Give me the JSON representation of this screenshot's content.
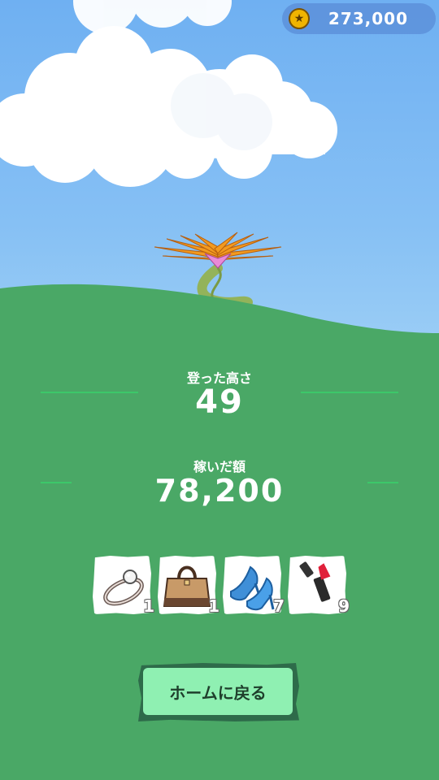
{
  "status_bar": {
    "coins": "273,000",
    "coin_icon": "star-coin-icon"
  },
  "results": {
    "height_label": "登った高さ",
    "height_value": "49",
    "earnings_label": "稼いだ額",
    "earnings_value": "78,200"
  },
  "items": [
    {
      "name": "ring",
      "icon": "ring-icon",
      "count": "1"
    },
    {
      "name": "handbag",
      "icon": "handbag-icon",
      "count": "1"
    },
    {
      "name": "high-heels",
      "icon": "high-heel-icon",
      "count": "7"
    },
    {
      "name": "lipstick",
      "icon": "lipstick-icon",
      "count": "9"
    }
  ],
  "home_button": {
    "label": "ホームに戻る"
  },
  "colors": {
    "sky": "#7bb8f4",
    "grass": "#4aa866",
    "button_fill": "#8ff0b2",
    "button_border": "#2e6b4a",
    "coin_pill": "#5a8cd7"
  }
}
